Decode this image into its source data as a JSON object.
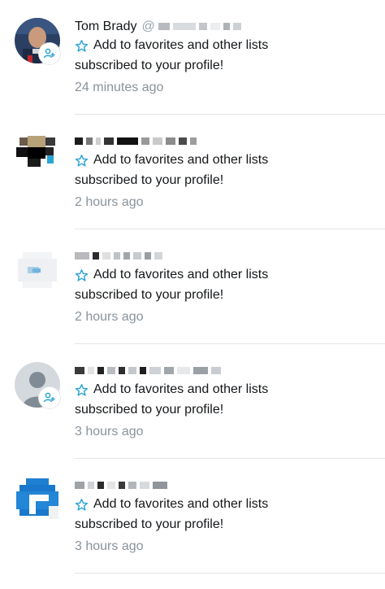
{
  "notifications": [
    {
      "name": "Tom Brady",
      "handle": "@",
      "action": "Add to favorites and other lists",
      "text": "subscribed to your profile!",
      "time": "24 minutes ago"
    },
    {
      "name": "",
      "handle": "",
      "action": "Add to favorites and other lists",
      "text": "subscribed to your profile!",
      "time": "2 hours ago"
    },
    {
      "name": "",
      "handle": "",
      "action": "Add to favorites and other lists",
      "text": "subscribed to your profile!",
      "time": "2 hours ago"
    },
    {
      "name": "",
      "handle": "",
      "action": "Add to favorites and other lists",
      "text": "subscribed to your profile!",
      "time": "3 hours ago"
    },
    {
      "name": "",
      "handle": "",
      "action": "Add to favorites and other lists",
      "text": "subscribed to your profile!",
      "time": "3 hours ago"
    }
  ],
  "colors": {
    "accent": "#2aa3d6",
    "muted": "#8a939b",
    "divider": "#e2e5e8"
  },
  "icons": {
    "favorite": "star-outline-icon",
    "badge": "subscriber-icon"
  }
}
